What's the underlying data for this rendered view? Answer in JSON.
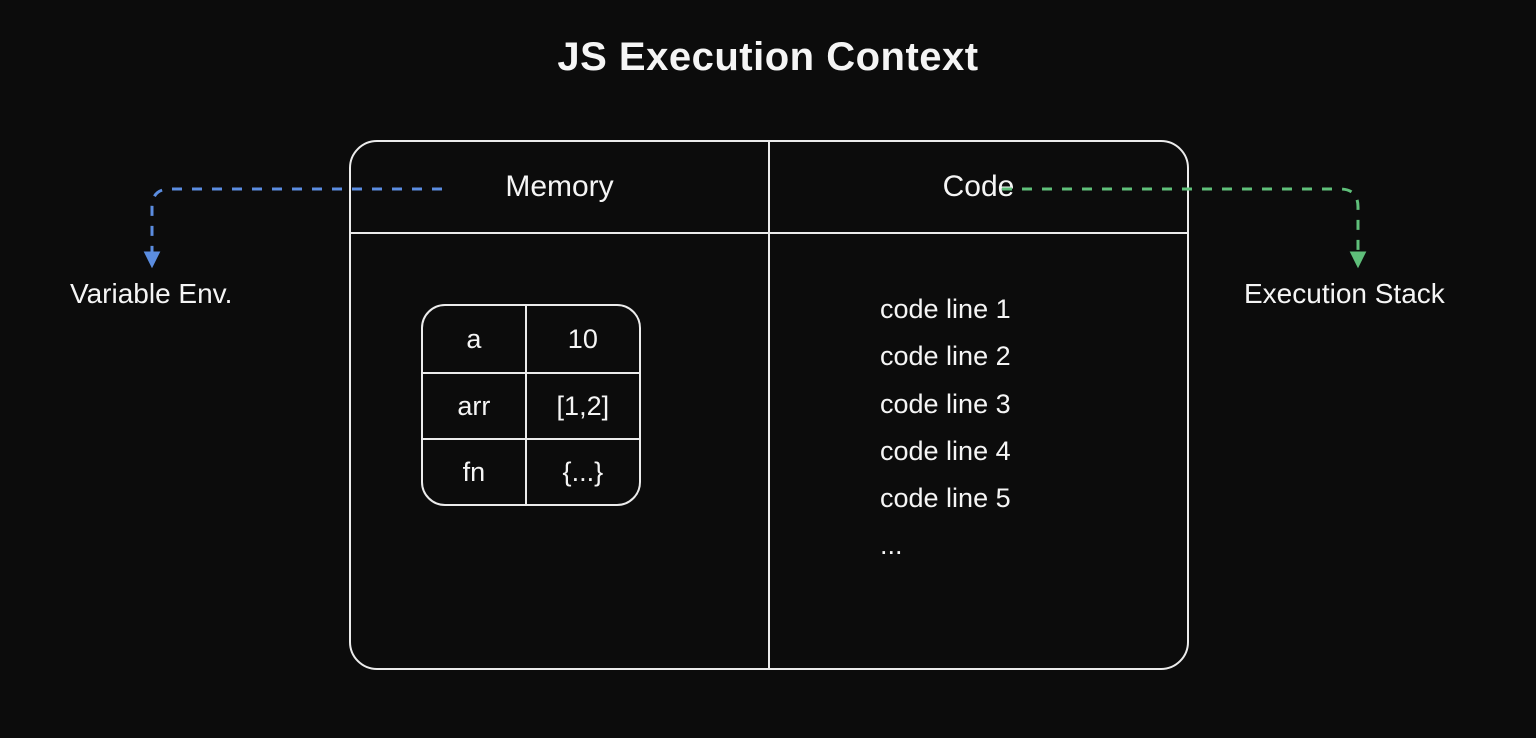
{
  "title": "JS Execution Context",
  "columns": {
    "memory_label": "Memory",
    "code_label": "Code"
  },
  "memory_rows": [
    {
      "key": "a",
      "value": "10"
    },
    {
      "key": "arr",
      "value": "[1,2]"
    },
    {
      "key": "fn",
      "value": "{...}"
    }
  ],
  "code_lines": [
    "code line 1",
    "code line 2",
    "code line 3",
    "code line 4",
    "code line 5",
    "..."
  ],
  "annotations": {
    "left_label": "Variable Env.",
    "right_label": "Execution Stack"
  },
  "colors": {
    "arrow_left": "#5b8de0",
    "arrow_right": "#5fbf7a"
  }
}
